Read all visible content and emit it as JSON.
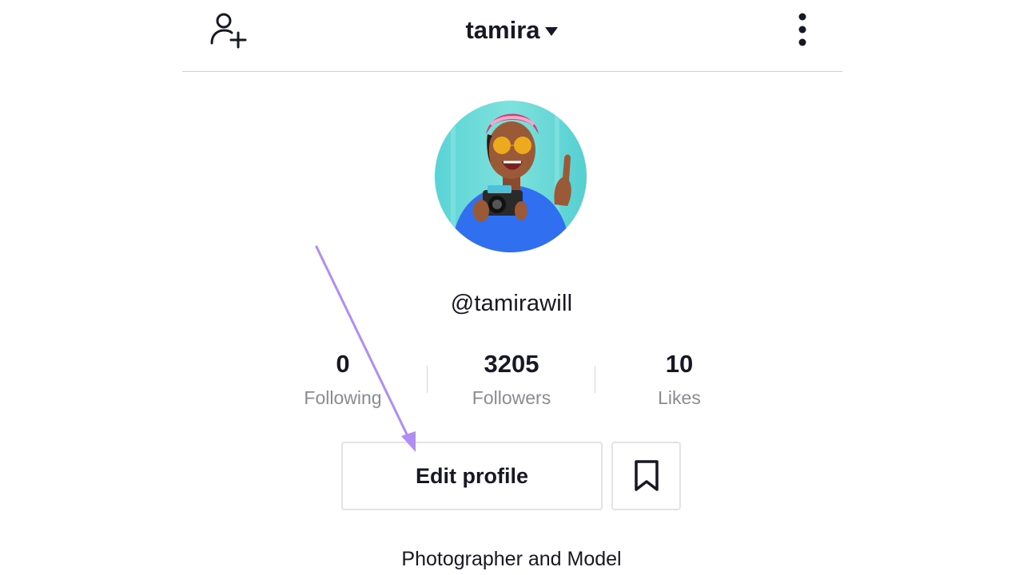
{
  "header": {
    "username": "tamira",
    "add_user_icon": "add-user-icon",
    "caret_icon": "caret-down-icon",
    "more_icon": "more-vertical-icon"
  },
  "profile": {
    "handle": "@tamirawill",
    "bio": "Photographer and Model"
  },
  "stats": [
    {
      "value": "0",
      "label": "Following"
    },
    {
      "value": "3205",
      "label": "Followers"
    },
    {
      "value": "10",
      "label": "Likes"
    }
  ],
  "actions": {
    "edit_label": "Edit profile",
    "bookmark_icon": "bookmark-icon"
  },
  "annotation": {
    "arrow_color": "#b18cf5"
  }
}
